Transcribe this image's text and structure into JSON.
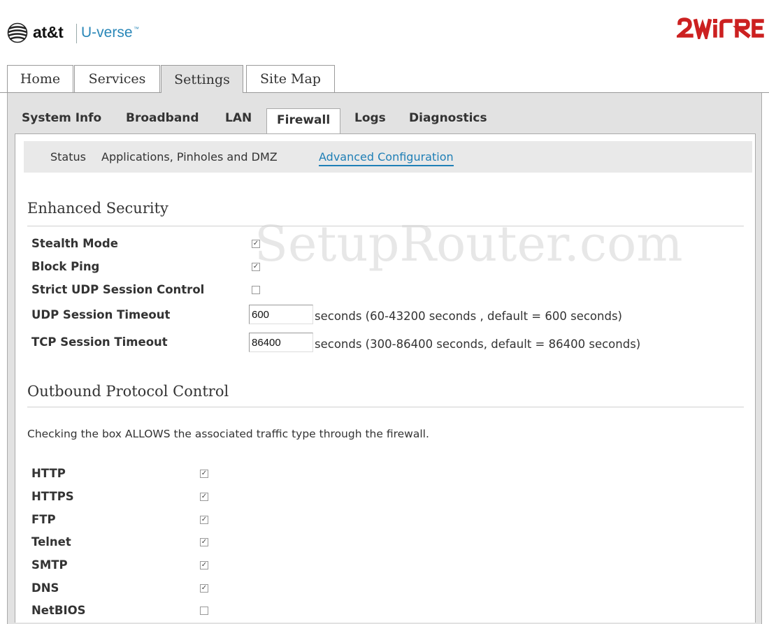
{
  "header": {
    "brand_att": "at&t",
    "brand_uverse": "U-verse",
    "brand_tm": "™",
    "partner_logo": "2WIRE",
    "colors": {
      "att_blue": "#2a87b8",
      "partner_red": "#cc2020"
    }
  },
  "top_tabs": [
    {
      "label": "Home"
    },
    {
      "label": "Services"
    },
    {
      "label": "Settings",
      "active": true
    },
    {
      "label": "Site Map"
    }
  ],
  "sub_tabs": [
    {
      "label": "System Info"
    },
    {
      "label": "Broadband"
    },
    {
      "label": "LAN"
    },
    {
      "label": "Firewall",
      "active": true
    },
    {
      "label": "Logs"
    },
    {
      "label": "Diagnostics"
    }
  ],
  "subnav": {
    "items": [
      "Status",
      "Applications, Pinholes and DMZ",
      "Advanced Configuration"
    ],
    "current": "Advanced Configuration"
  },
  "watermark": "SetupRouter.com",
  "enhanced_security": {
    "title": "Enhanced Security",
    "rows": [
      {
        "label": "Stealth Mode",
        "checked": true
      },
      {
        "label": "Block Ping",
        "checked": true
      },
      {
        "label": "Strict UDP Session Control",
        "checked": false
      }
    ],
    "udp_timeout": {
      "label": "UDP Session Timeout",
      "value": "600",
      "hint": "seconds (60-43200 seconds , default = 600 seconds)"
    },
    "tcp_timeout": {
      "label": "TCP Session Timeout",
      "value": "86400",
      "hint": "seconds (300-86400 seconds, default = 86400 seconds)"
    }
  },
  "outbound": {
    "title": "Outbound Protocol Control",
    "note": "Checking the box ALLOWS the associated traffic type through the firewall.",
    "protocols": [
      {
        "label": "HTTP",
        "checked": true
      },
      {
        "label": "HTTPS",
        "checked": true
      },
      {
        "label": "FTP",
        "checked": true
      },
      {
        "label": "Telnet",
        "checked": true
      },
      {
        "label": "SMTP",
        "checked": true
      },
      {
        "label": "DNS",
        "checked": true
      },
      {
        "label": "NetBIOS",
        "checked": false
      }
    ]
  }
}
